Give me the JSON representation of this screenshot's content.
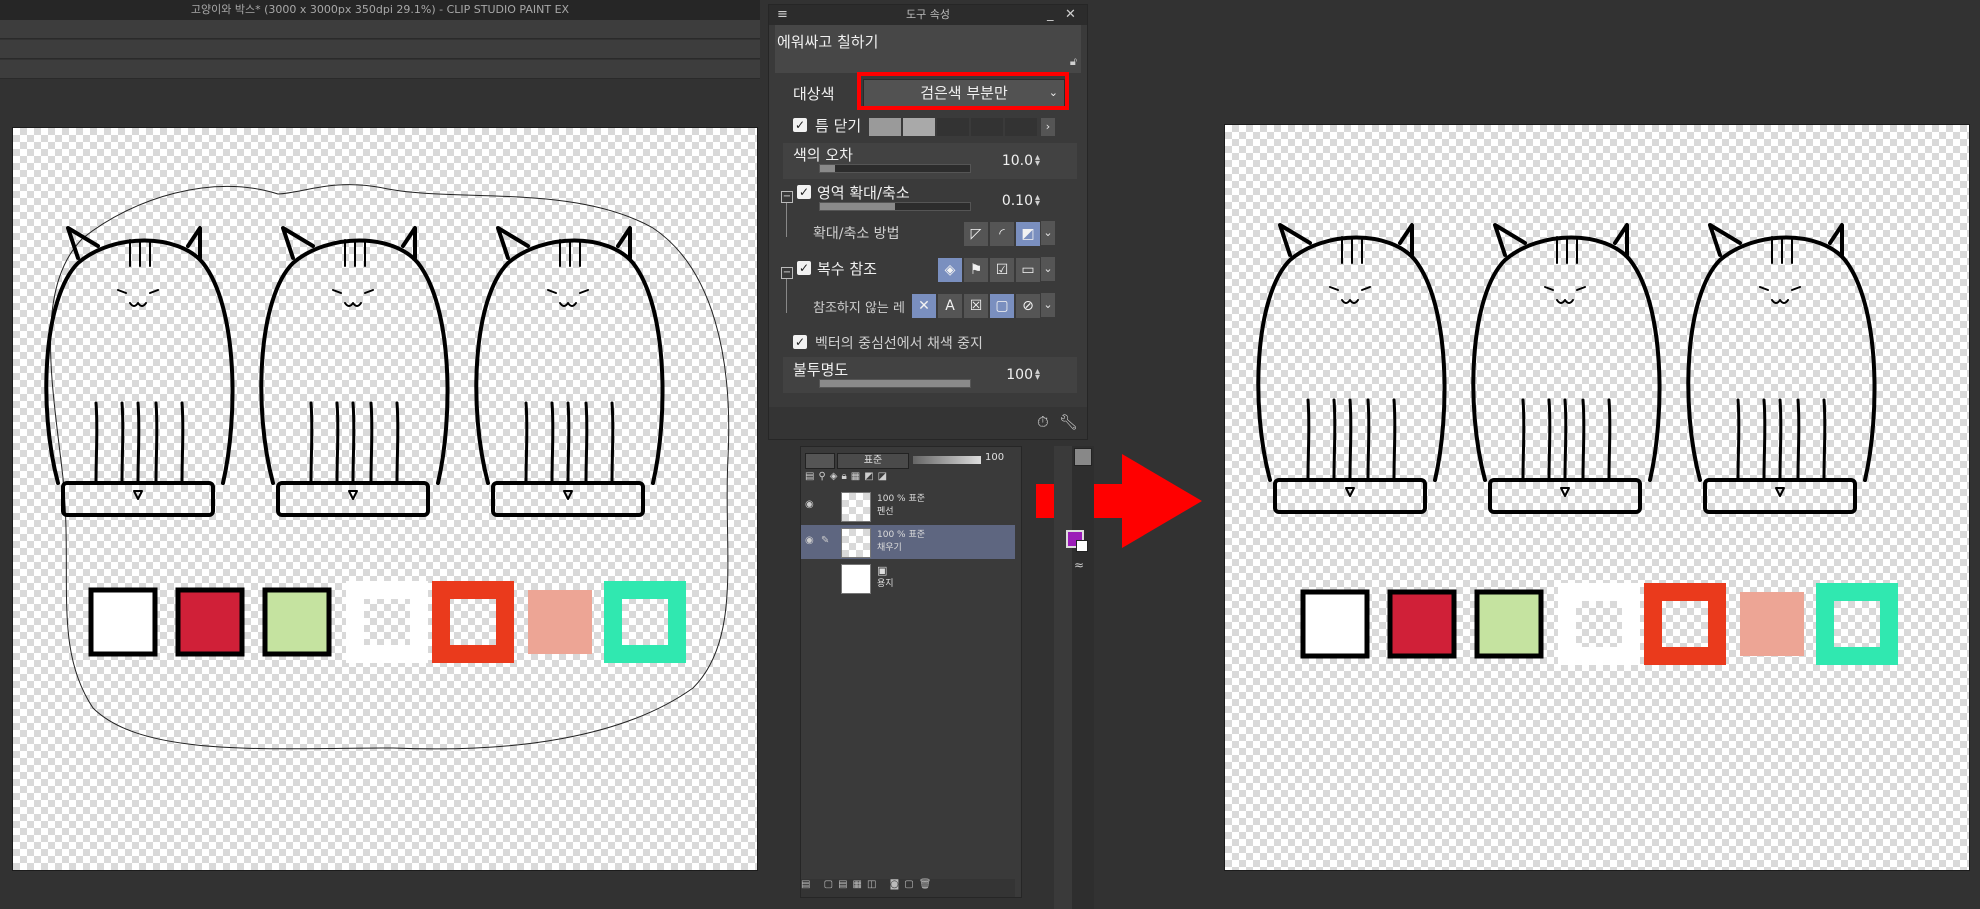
{
  "app": {
    "window_title": "고양이와 박스* (3000 x 3000px 350dpi 29.1%)  - CLIP STUDIO PAINT EX"
  },
  "tool_property": {
    "panel_title": "도구 속성",
    "tool_name": "에워싸고 칠하기",
    "target_color": {
      "label": "대상색",
      "value": "검은색 부분만"
    },
    "close_gap": {
      "label": "틈 닫기",
      "checked": true
    },
    "color_margin": {
      "label": "색의 오차",
      "value": "10.0",
      "fraction": 0.1
    },
    "area_scaling": {
      "label": "영역 확대/축소",
      "checked": true,
      "value": "0.10",
      "fraction": 0.5
    },
    "scaling_mode": {
      "label": "확대/축소 방법"
    },
    "multi_refer": {
      "label": "복수 참조",
      "checked": true
    },
    "exclude_refer": {
      "label": "참조하지 않는 레"
    },
    "vector_stop": {
      "label": "벡터의 중심선에서 채색 중지",
      "checked": true
    },
    "opacity": {
      "label": "불투명도",
      "value": "100",
      "fraction": 1.0
    }
  },
  "layers": {
    "blend_mode": "표준",
    "opacity_value": "100",
    "items": [
      {
        "line1": "100 % 표준",
        "line2": "펜선",
        "selected": false
      },
      {
        "line1": "100 % 표준",
        "line2": "채우기",
        "selected": true
      },
      {
        "line1": "",
        "line2": "용지",
        "selected": false
      }
    ]
  },
  "colors": {
    "accent_red": "#ff0000",
    "swatch_white": "#ffffff",
    "swatch_crimson": "#d02038",
    "swatch_lime": "#c5e3a0",
    "swatch_orange": "#ea3a1c",
    "swatch_salmon": "#eda595",
    "swatch_teal": "#30e8b0",
    "main_color": "#9b1cb8",
    "sub_color": "#ffffff"
  },
  "icons": {
    "arrow": "right-arrow-icon",
    "lock": "lock-icon"
  }
}
